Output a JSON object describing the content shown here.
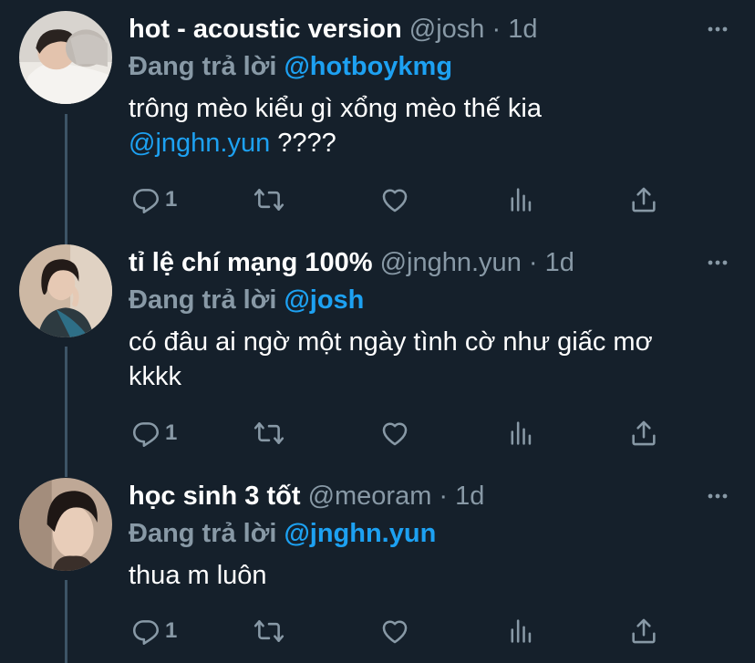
{
  "colors": {
    "background": "#15202b",
    "accent": "#1da1f2",
    "secondary_text": "#8899a6",
    "thread_line": "#3d5466"
  },
  "replies": [
    {
      "name": "hot - acoustic version",
      "handle": "@josh",
      "separator": "·",
      "time": "1d",
      "replying_label": "Đang trả lời",
      "replying_to": "@hotboykmg",
      "text_before": "trông mèo kiểu gì xổng mèo thế kia",
      "text_mention": "@jnghn.yun",
      "text_after": " ????",
      "reply_count": "1",
      "avatar_icon": "avatar-photo"
    },
    {
      "name": "tỉ lệ chí mạng 100%",
      "handle": "@jnghn.yun",
      "separator": "·",
      "time": "1d",
      "replying_label": "Đang trả lời",
      "replying_to": "@josh",
      "text": "có đâu ai ngờ một ngày tình cờ như giấc mơ kkkk",
      "reply_count": "1",
      "avatar_icon": "avatar-photo"
    },
    {
      "name": "học sinh 3 tốt",
      "handle": "@meoram",
      "separator": "·",
      "time": "1d",
      "replying_label": "Đang trả lời",
      "replying_to": "@jnghn.yun",
      "text": "thua m luôn",
      "reply_count": "1",
      "avatar_icon": "avatar-photo"
    }
  ],
  "icons": {
    "reply": "reply-icon",
    "retweet": "retweet-icon",
    "like": "heart-icon",
    "analytics": "analytics-icon",
    "share": "share-icon",
    "more": "more-icon"
  }
}
